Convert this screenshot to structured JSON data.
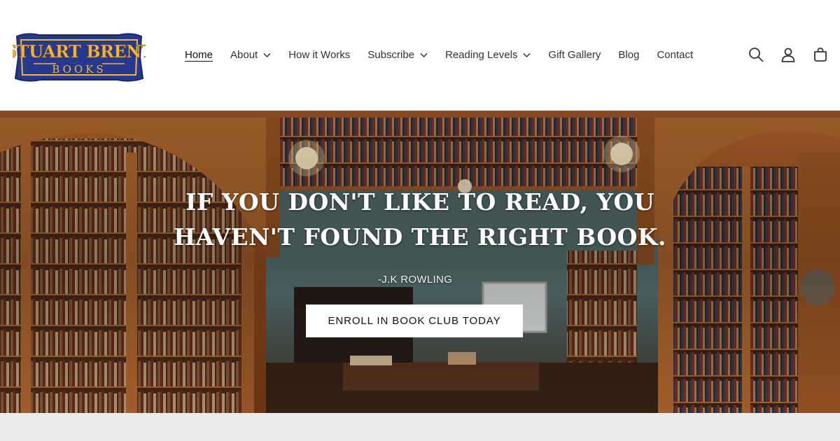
{
  "brand": {
    "name_line1": "STUART BRENT",
    "name_line2": "BOOKS",
    "colors": {
      "blue": "#27388f",
      "gold": "#f0b640",
      "navy": "#1c2a5c"
    }
  },
  "nav": {
    "items": [
      {
        "label": "Home",
        "active": true,
        "dropdown": false
      },
      {
        "label": "About",
        "active": false,
        "dropdown": true
      },
      {
        "label": "How it Works",
        "active": false,
        "dropdown": false
      },
      {
        "label": "Subscribe",
        "active": false,
        "dropdown": true
      },
      {
        "label": "Reading Levels",
        "active": false,
        "dropdown": true
      },
      {
        "label": "Gift Gallery",
        "active": false,
        "dropdown": false
      },
      {
        "label": "Blog",
        "active": false,
        "dropdown": false
      },
      {
        "label": "Contact",
        "active": false,
        "dropdown": false
      }
    ]
  },
  "header_icons": [
    "search-icon",
    "account-icon",
    "cart-icon"
  ],
  "hero": {
    "quote_line1": "IF YOU DON'T LIKE TO READ, YOU",
    "quote_line2": "HAVEN'T FOUND THE RIGHT BOOK.",
    "attribution": "-J.K ROWLING",
    "cta_label": "ENROLL IN BOOK CLUB TODAY",
    "background": "library-interior-image"
  }
}
